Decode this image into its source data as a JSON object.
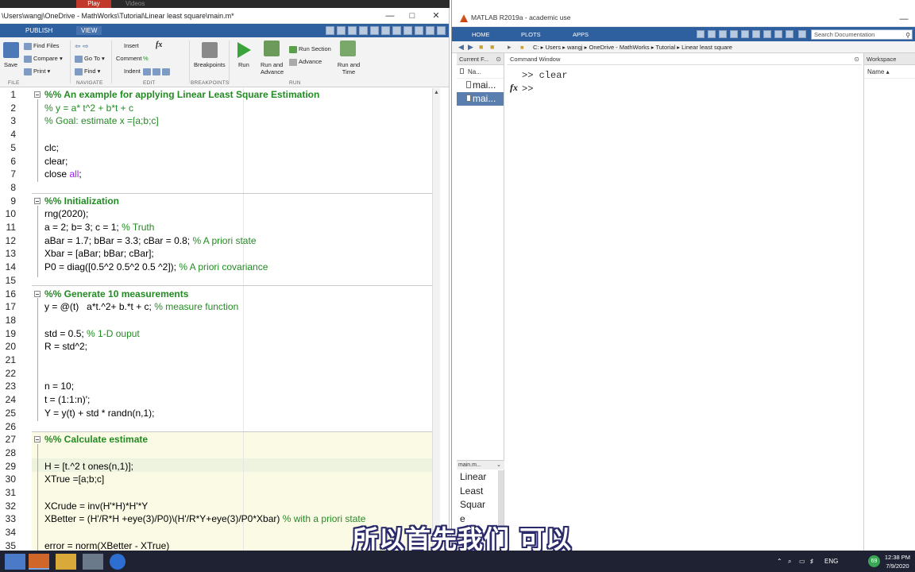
{
  "top_strip": {
    "tab_play": "Play",
    "tab_videos": "Videos"
  },
  "editor": {
    "title": "\\Users\\wangj\\OneDrive - MathWorks\\Tutorial\\Linear least square\\main.m*",
    "ribbon_tabs": [
      "PUBLISH",
      "VIEW"
    ],
    "ribbon": {
      "save": "Save",
      "find_files": "Find Files",
      "compare": "Compare",
      "print": "Print",
      "go_to": "Go To",
      "find": "Find",
      "insert": "Insert",
      "comment": "Comment",
      "indent": "Indent",
      "breakpoints": "Breakpoints",
      "run": "Run",
      "run_and_advance": "Run and Advance",
      "run_section": "Run Section",
      "advance": "Advance",
      "run_and_time": "Run and Time",
      "sections": [
        "FILE",
        "NAVIGATE",
        "EDIT",
        "BREAKPOINTS",
        "RUN"
      ]
    },
    "lines": [
      {
        "n": "1",
        "t": "%% An example for applying Linear Least Square Estimation",
        "k": "section"
      },
      {
        "n": "2",
        "t": "% y = a* t^2 + b*t + c",
        "k": "comment"
      },
      {
        "n": "3",
        "t": "% Goal: estimate x =[a;b;c]",
        "k": "comment"
      },
      {
        "n": "4",
        "t": "",
        "k": "code"
      },
      {
        "n": "5",
        "t": "clc;",
        "k": "code"
      },
      {
        "n": "6",
        "t": "clear;",
        "k": "code"
      },
      {
        "n": "7",
        "t": "close ",
        "k": "code",
        "kw": "all",
        "tail": ";"
      },
      {
        "n": "8",
        "t": "",
        "k": "code"
      },
      {
        "n": "9",
        "t": "%% Initialization",
        "k": "section"
      },
      {
        "n": "10",
        "t": "rng(2020);",
        "k": "code"
      },
      {
        "n": "11",
        "t": "a = 2; b= 3; c = 1; ",
        "k": "code",
        "cm": "% Truth"
      },
      {
        "n": "12",
        "t": "aBar = 1.7; bBar = 3.3; cBar = 0.8; ",
        "k": "code",
        "cm": "% A priori state"
      },
      {
        "n": "13",
        "t": "Xbar = [aBar; bBar; cBar];",
        "k": "code"
      },
      {
        "n": "14",
        "t": "P0 = diag([0.5^2 0.5^2 0.5 ^2]); ",
        "k": "code",
        "cm": "% A priori covariance"
      },
      {
        "n": "15",
        "t": "",
        "k": "code"
      },
      {
        "n": "16",
        "t": "%% Generate 10 measurements",
        "k": "section"
      },
      {
        "n": "17",
        "t": "y = @(t)   a*t.^2+ b.*t + c; ",
        "k": "code",
        "cm": "% measure function"
      },
      {
        "n": "18",
        "t": "",
        "k": "code"
      },
      {
        "n": "19",
        "t": "std = 0.5; ",
        "k": "code",
        "cm": "% 1-D ouput"
      },
      {
        "n": "20",
        "t": "R = std^2;",
        "k": "code"
      },
      {
        "n": "21",
        "t": "",
        "k": "code"
      },
      {
        "n": "22",
        "t": "",
        "k": "code"
      },
      {
        "n": "23",
        "t": "n = 10;",
        "k": "code"
      },
      {
        "n": "24",
        "t": "t = (1:1:n)';",
        "k": "code"
      },
      {
        "n": "25",
        "t": "Y = y(t) + std * randn(n,1);",
        "k": "code"
      },
      {
        "n": "26",
        "t": "",
        "k": "code"
      },
      {
        "n": "27",
        "t": "%% Calculate estimate",
        "k": "section"
      },
      {
        "n": "28",
        "t": "",
        "k": "code"
      },
      {
        "n": "29",
        "t": "H = [t.^2 t ones(n,1)];",
        "k": "code"
      },
      {
        "n": "30",
        "t": "XTrue =[a;b;c]",
        "k": "code"
      },
      {
        "n": "31",
        "t": "",
        "k": "code"
      },
      {
        "n": "32",
        "t": "XCrude = inv(H'*H)*H'*Y",
        "k": "code"
      },
      {
        "n": "33",
        "t": "XBetter = (H'/R*H +eye(3)/P0)\\(H'/R*Y+eye(3)/P0*Xbar) ",
        "k": "code",
        "cm": "% with a priori state"
      },
      {
        "n": "34",
        "t": "",
        "k": "code"
      },
      {
        "n": "35",
        "t": "error = norm(XBetter - XTrue)",
        "k": "code"
      }
    ]
  },
  "matlab": {
    "title": "MATLAB R2019a - academic use",
    "tabs": [
      "HOME",
      "PLOTS",
      "APPS"
    ],
    "search_placeholder": "Search Documentation",
    "path": [
      "C:",
      "Users",
      "wangj",
      "OneDrive - MathWorks",
      "Tutorial",
      "Linear least square"
    ],
    "current_folder": {
      "header": "Current F...",
      "col_name": "Na...",
      "items": [
        "mai...",
        "mai..."
      ],
      "detail_header": "main.m...",
      "detail_text": [
        "Linear",
        "Least",
        "Squar",
        "e"
      ]
    },
    "command_window": {
      "header": "Command Window",
      "lines": [
        ">> clear",
        ">>"
      ]
    },
    "workspace": {
      "header": "Workspace",
      "col_name": "Name"
    }
  },
  "subtitle": "所以首先我们 可以",
  "taskbar": {
    "lang": "ENG",
    "badge": "69",
    "time": "12:38 PM",
    "date": "7/9/2020"
  }
}
